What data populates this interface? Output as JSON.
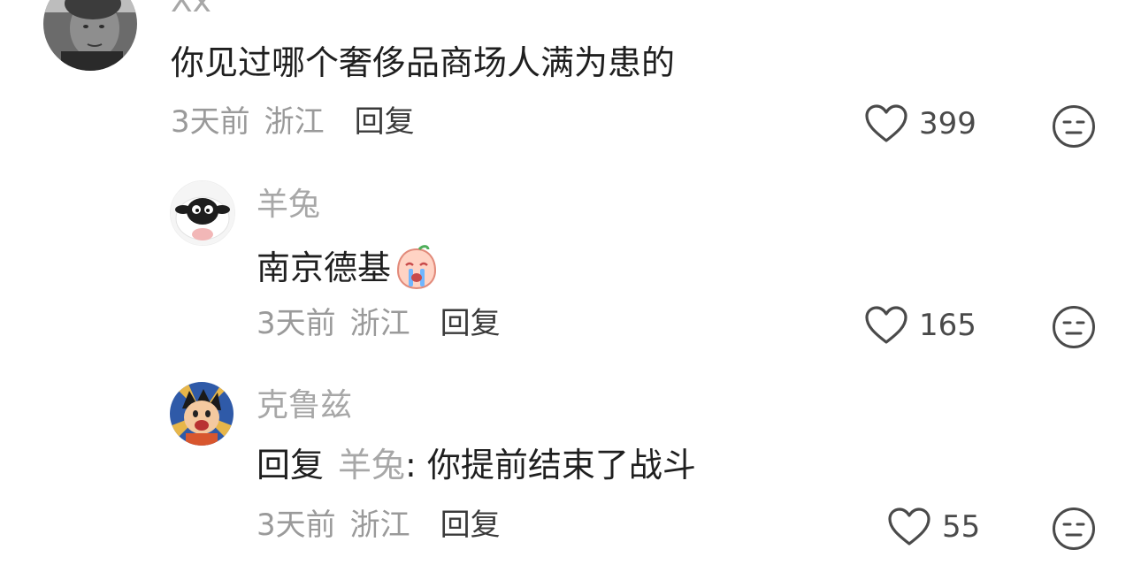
{
  "comments": [
    {
      "username": "Xx",
      "text": "你见过哪个奢侈品商场人满为患的",
      "time": "3天前",
      "location": "浙江",
      "reply_label": "回复",
      "likes": "399"
    },
    {
      "username": "羊兔",
      "text": "南京德基",
      "emoji": "crying-face-emoji",
      "time": "3天前",
      "location": "浙江",
      "reply_label": "回复",
      "likes": "165"
    },
    {
      "username": "克鲁兹",
      "reply_prefix": "回复",
      "reply_to": "羊兔",
      "text": ": 你提前结束了战斗",
      "time": "3天前",
      "location": "浙江",
      "reply_label": "回复",
      "likes": "55"
    }
  ],
  "icons": {
    "like": "heart-outline-icon",
    "dislike": "unamused-face-icon"
  },
  "colors": {
    "username": "#a7a7a7",
    "text": "#1f1f1f",
    "meta": "#9a9a9a",
    "icon": "#4a4a4a"
  }
}
